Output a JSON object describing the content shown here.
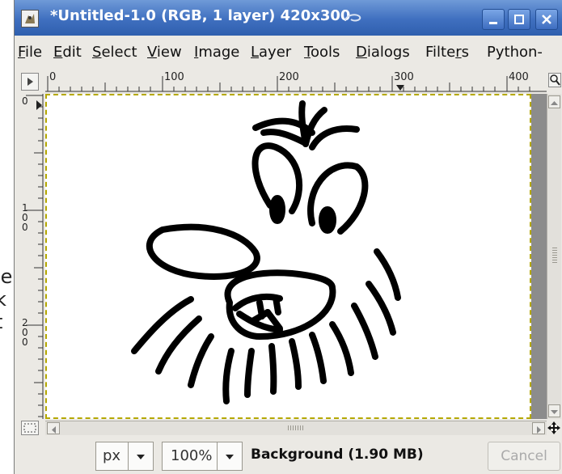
{
  "window": {
    "title": "*Untitled-1.0 (RGB, 1 layer) 420x300",
    "title_colors": {
      "start": "#6f9ad8",
      "end": "#2f5fae"
    }
  },
  "background_text": [
    "le",
    "k",
    "t"
  ],
  "menubar": {
    "items": [
      {
        "label": "File",
        "mnemonic": "F",
        "rest": "ile"
      },
      {
        "label": "Edit",
        "mnemonic": "E",
        "rest": "dit"
      },
      {
        "label": "Select",
        "mnemonic": "S",
        "rest": "elect"
      },
      {
        "label": "View",
        "mnemonic": "V",
        "rest": "iew"
      },
      {
        "label": "Image",
        "mnemonic": "I",
        "rest": "mage"
      },
      {
        "label": "Layer",
        "mnemonic": "L",
        "rest": "ayer"
      },
      {
        "label": "Tools",
        "mnemonic": "T",
        "rest": "ools"
      },
      {
        "label": "Dialogs",
        "mnemonic": "D",
        "rest": "ialogs"
      },
      {
        "label": "Filters",
        "prefix": "Filte",
        "mnemonic": "r",
        "rest": "s"
      },
      {
        "label": "Python-",
        "mnemonic": "",
        "rest": "Python-"
      }
    ]
  },
  "rulers": {
    "horizontal_labels": [
      "0",
      "100",
      "200",
      "300",
      "400"
    ],
    "vertical_labels": [
      "0",
      "100",
      "200"
    ]
  },
  "statusbar": {
    "unit": "px",
    "zoom": "100%",
    "message": "Background (1.90 MB)",
    "cancel_label": "Cancel"
  },
  "icons": [
    "gimp-wilber-icon",
    "minimize-icon",
    "maximize-icon",
    "close-icon",
    "zoom-icon",
    "quick-mask-icon",
    "navigate-icon",
    "menu-arrow-icon"
  ]
}
